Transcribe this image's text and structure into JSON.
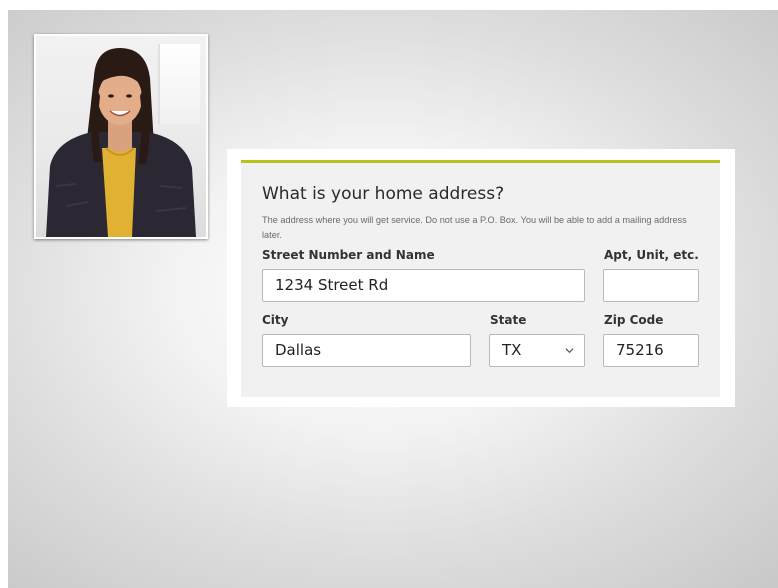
{
  "form": {
    "title": "What is your home address?",
    "description": "The address where you will get service. Do not use a P.O. Box. You will be able to add a mailing address later.",
    "street": {
      "label": "Street Number and Name",
      "value": "1234 Street Rd"
    },
    "apt": {
      "label": "Apt, Unit, etc.",
      "value": ""
    },
    "city": {
      "label": "City",
      "value": "Dallas"
    },
    "state": {
      "label": "State",
      "value": "TX",
      "icon": "chevron-down-icon"
    },
    "zip": {
      "label": "Zip Code",
      "value": "75216"
    }
  },
  "colors": {
    "accent": "#b7c31a",
    "panel": "#f1f1f1",
    "field_border": "#b9b9b9"
  }
}
